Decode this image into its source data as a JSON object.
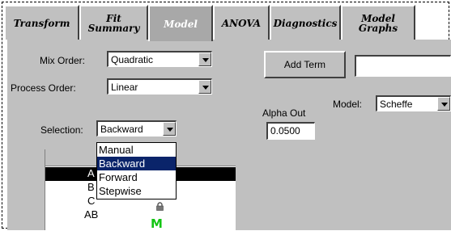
{
  "tabs": [
    {
      "label": "Transform"
    },
    {
      "label": "Fit\nSummary"
    },
    {
      "label": "Model"
    },
    {
      "label": "ANOVA"
    },
    {
      "label": "Diagnostics"
    },
    {
      "label": "Model\nGraphs"
    }
  ],
  "mix_order": {
    "label": "Mix Order:",
    "value": "Quadratic"
  },
  "process_order": {
    "label": "Process Order:",
    "value": "Linear"
  },
  "add_term": {
    "label": "Add Term",
    "input_value": ""
  },
  "alpha_out": {
    "label": "Alpha Out",
    "value": "0.0500"
  },
  "model": {
    "label": "Model:",
    "value": "Scheffe"
  },
  "selection": {
    "label": "Selection:",
    "value": "Backward",
    "options": [
      "Manual",
      "Backward",
      "Forward",
      "Stepwise"
    ]
  },
  "terms": [
    {
      "name": "A"
    },
    {
      "name": "B"
    },
    {
      "name": "C"
    },
    {
      "name": "AB"
    }
  ],
  "term_marks": {
    "locked": "lock-icon",
    "model_term": "M"
  }
}
